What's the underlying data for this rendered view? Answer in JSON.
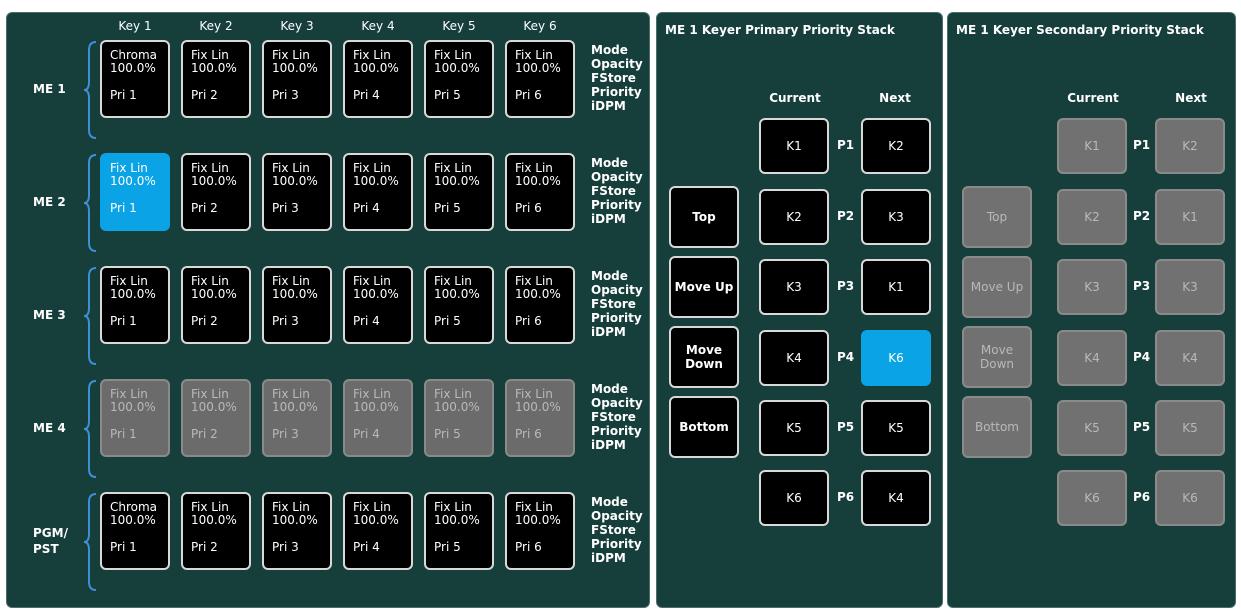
{
  "keys": [
    "Key 1",
    "Key 2",
    "Key 3",
    "Key 4",
    "Key 5",
    "Key 6"
  ],
  "params": [
    "Mode",
    "Opacity",
    "FStore",
    "Priority",
    "iDPM"
  ],
  "rows": [
    {
      "label": "ME 1",
      "cells": [
        {
          "mode": "Chroma",
          "opacity": "100.0%",
          "pri": "Pri 1"
        },
        {
          "mode": "Fix Lin",
          "opacity": "100.0%",
          "pri": "Pri 2"
        },
        {
          "mode": "Fix Lin",
          "opacity": "100.0%",
          "pri": "Pri 3"
        },
        {
          "mode": "Fix Lin",
          "opacity": "100.0%",
          "pri": "Pri 4"
        },
        {
          "mode": "Fix Lin",
          "opacity": "100.0%",
          "pri": "Pri 5"
        },
        {
          "mode": "Fix Lin",
          "opacity": "100.0%",
          "pri": "Pri 6"
        }
      ]
    },
    {
      "label": "ME 2",
      "cells": [
        {
          "mode": "Fix Lin",
          "opacity": "100.0%",
          "pri": "Pri 1"
        },
        {
          "mode": "Fix Lin",
          "opacity": "100.0%",
          "pri": "Pri 2"
        },
        {
          "mode": "Fix Lin",
          "opacity": "100.0%",
          "pri": "Pri 3"
        },
        {
          "mode": "Fix Lin",
          "opacity": "100.0%",
          "pri": "Pri 4"
        },
        {
          "mode": "Fix Lin",
          "opacity": "100.0%",
          "pri": "Pri 5"
        },
        {
          "mode": "Fix Lin",
          "opacity": "100.0%",
          "pri": "Pri 6"
        }
      ]
    },
    {
      "label": "ME 3",
      "cells": [
        {
          "mode": "Fix Lin",
          "opacity": "100.0%",
          "pri": "Pri 1"
        },
        {
          "mode": "Fix Lin",
          "opacity": "100.0%",
          "pri": "Pri 2"
        },
        {
          "mode": "Fix Lin",
          "opacity": "100.0%",
          "pri": "Pri 3"
        },
        {
          "mode": "Fix Lin",
          "opacity": "100.0%",
          "pri": "Pri 4"
        },
        {
          "mode": "Fix Lin",
          "opacity": "100.0%",
          "pri": "Pri 5"
        },
        {
          "mode": "Fix Lin",
          "opacity": "100.0%",
          "pri": "Pri 6"
        }
      ]
    },
    {
      "label": "ME 4",
      "cells": [
        {
          "mode": "Fix Lin",
          "opacity": "100.0%",
          "pri": "Pri 1"
        },
        {
          "mode": "Fix Lin",
          "opacity": "100.0%",
          "pri": "Pri 2"
        },
        {
          "mode": "Fix Lin",
          "opacity": "100.0%",
          "pri": "Pri 3"
        },
        {
          "mode": "Fix Lin",
          "opacity": "100.0%",
          "pri": "Pri 4"
        },
        {
          "mode": "Fix Lin",
          "opacity": "100.0%",
          "pri": "Pri 5"
        },
        {
          "mode": "Fix Lin",
          "opacity": "100.0%",
          "pri": "Pri 6"
        }
      ]
    },
    {
      "label": "PGM/\nPST",
      "cells": [
        {
          "mode": "Chroma",
          "opacity": "100.0%",
          "pri": "Pri 1"
        },
        {
          "mode": "Fix Lin",
          "opacity": "100.0%",
          "pri": "Pri 2"
        },
        {
          "mode": "Fix Lin",
          "opacity": "100.0%",
          "pri": "Pri 3"
        },
        {
          "mode": "Fix Lin",
          "opacity": "100.0%",
          "pri": "Pri 4"
        },
        {
          "mode": "Fix Lin",
          "opacity": "100.0%",
          "pri": "Pri 5"
        },
        {
          "mode": "Fix Lin",
          "opacity": "100.0%",
          "pri": "Pri 6"
        }
      ]
    }
  ],
  "selected_cell": {
    "row": 1,
    "col": 0
  },
  "disabled_row": 3,
  "primary": {
    "title": "ME 1 Keyer Primary Priority Stack",
    "current_label": "Current",
    "next_label": "Next",
    "positions": [
      "P1",
      "P2",
      "P3",
      "P4",
      "P5",
      "P6"
    ],
    "current": [
      "K1",
      "K2",
      "K3",
      "K4",
      "K5",
      "K6"
    ],
    "next": [
      "K2",
      "K3",
      "K1",
      "K6",
      "K5",
      "K4"
    ],
    "selected_next_index": 3,
    "actions": [
      "Top",
      "Move Up",
      "Move\nDown",
      "Bottom"
    ]
  },
  "secondary": {
    "title": "ME 1 Keyer Secondary Priority Stack",
    "current_label": "Current",
    "next_label": "Next",
    "positions": [
      "P1",
      "P2",
      "P3",
      "P4",
      "P5",
      "P6"
    ],
    "current": [
      "K1",
      "K2",
      "K3",
      "K4",
      "K5",
      "K6"
    ],
    "next": [
      "K2",
      "K1",
      "K3",
      "K4",
      "K5",
      "K6"
    ],
    "actions": [
      "Top",
      "Move Up",
      "Move\nDown",
      "Bottom"
    ]
  },
  "colors": {
    "panel_bg": "#163f3c",
    "selected": "#0aa3e6",
    "brace": "#3d8fd6",
    "disabled": "#6b6b6b"
  }
}
